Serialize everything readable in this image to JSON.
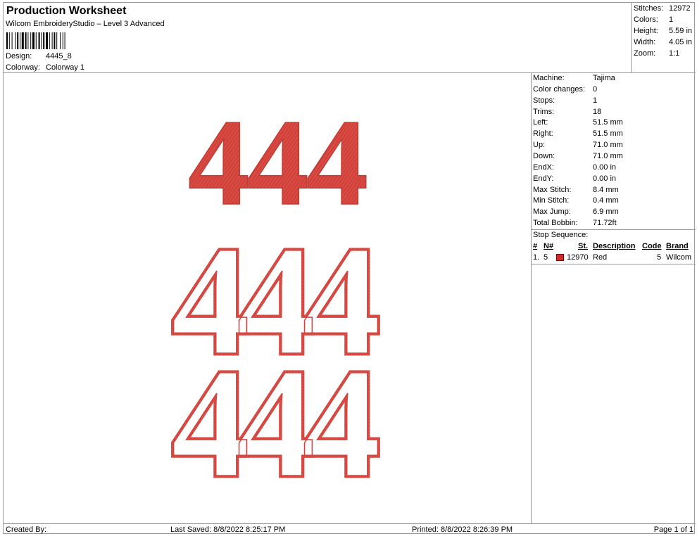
{
  "header": {
    "title": "Production Worksheet",
    "subtitle": "Wilcom EmbroideryStudio – Level 3 Advanced",
    "design_label": "Design:",
    "design_value": "4445_8",
    "colorway_label": "Colorway:",
    "colorway_value": "Colorway 1"
  },
  "stats": [
    {
      "label": "Stitches:",
      "value": "12972"
    },
    {
      "label": "Colors:",
      "value": "1"
    },
    {
      "label": "Height:",
      "value": "5.59 in"
    },
    {
      "label": "Width:",
      "value": "4.05 in"
    },
    {
      "label": "Zoom:",
      "value": "1:1"
    }
  ],
  "machine_info": [
    {
      "label": "Machine:",
      "value": "Tajima"
    },
    {
      "label": "Color changes:",
      "value": "0"
    },
    {
      "label": "Stops:",
      "value": "1"
    },
    {
      "label": "Trims:",
      "value": "18"
    },
    {
      "label": "Left:",
      "value": "51.5 mm"
    },
    {
      "label": "Right:",
      "value": "51.5 mm"
    },
    {
      "label": "Up:",
      "value": "71.0 mm"
    },
    {
      "label": "Down:",
      "value": "71.0 mm"
    },
    {
      "label": "EndX:",
      "value": "0.00 in"
    },
    {
      "label": "EndY:",
      "value": "0.00 in"
    },
    {
      "label": "Max Stitch:",
      "value": "8.4 mm"
    },
    {
      "label": "Min Stitch:",
      "value": "0.4 mm"
    },
    {
      "label": "Max Jump:",
      "value": "6.9 mm"
    },
    {
      "label": "Total Bobbin:",
      "value": "71.72ft"
    }
  ],
  "stop_sequence": {
    "label": "Stop Sequence:",
    "headers": {
      "num": "#",
      "n": "N#",
      "st": "St.",
      "description": "Description",
      "code": "Code",
      "brand": "Brand"
    },
    "rows": [
      {
        "num": "1.",
        "n": "5",
        "swatch_color": "#d02a2a",
        "st": "12970",
        "description": "Red",
        "code": "5",
        "brand": "Wilcom"
      }
    ]
  },
  "design": {
    "rows": [
      "444",
      "444",
      "444"
    ],
    "thread_color": "#d94a43",
    "dark_color": "#b8302b"
  },
  "footer": {
    "created_by": "Created By:",
    "last_saved": "Last Saved: 8/8/2022 8:25:17 PM",
    "printed": "Printed: 8/8/2022 8:26:39 PM",
    "page": "Page 1 of 1"
  }
}
